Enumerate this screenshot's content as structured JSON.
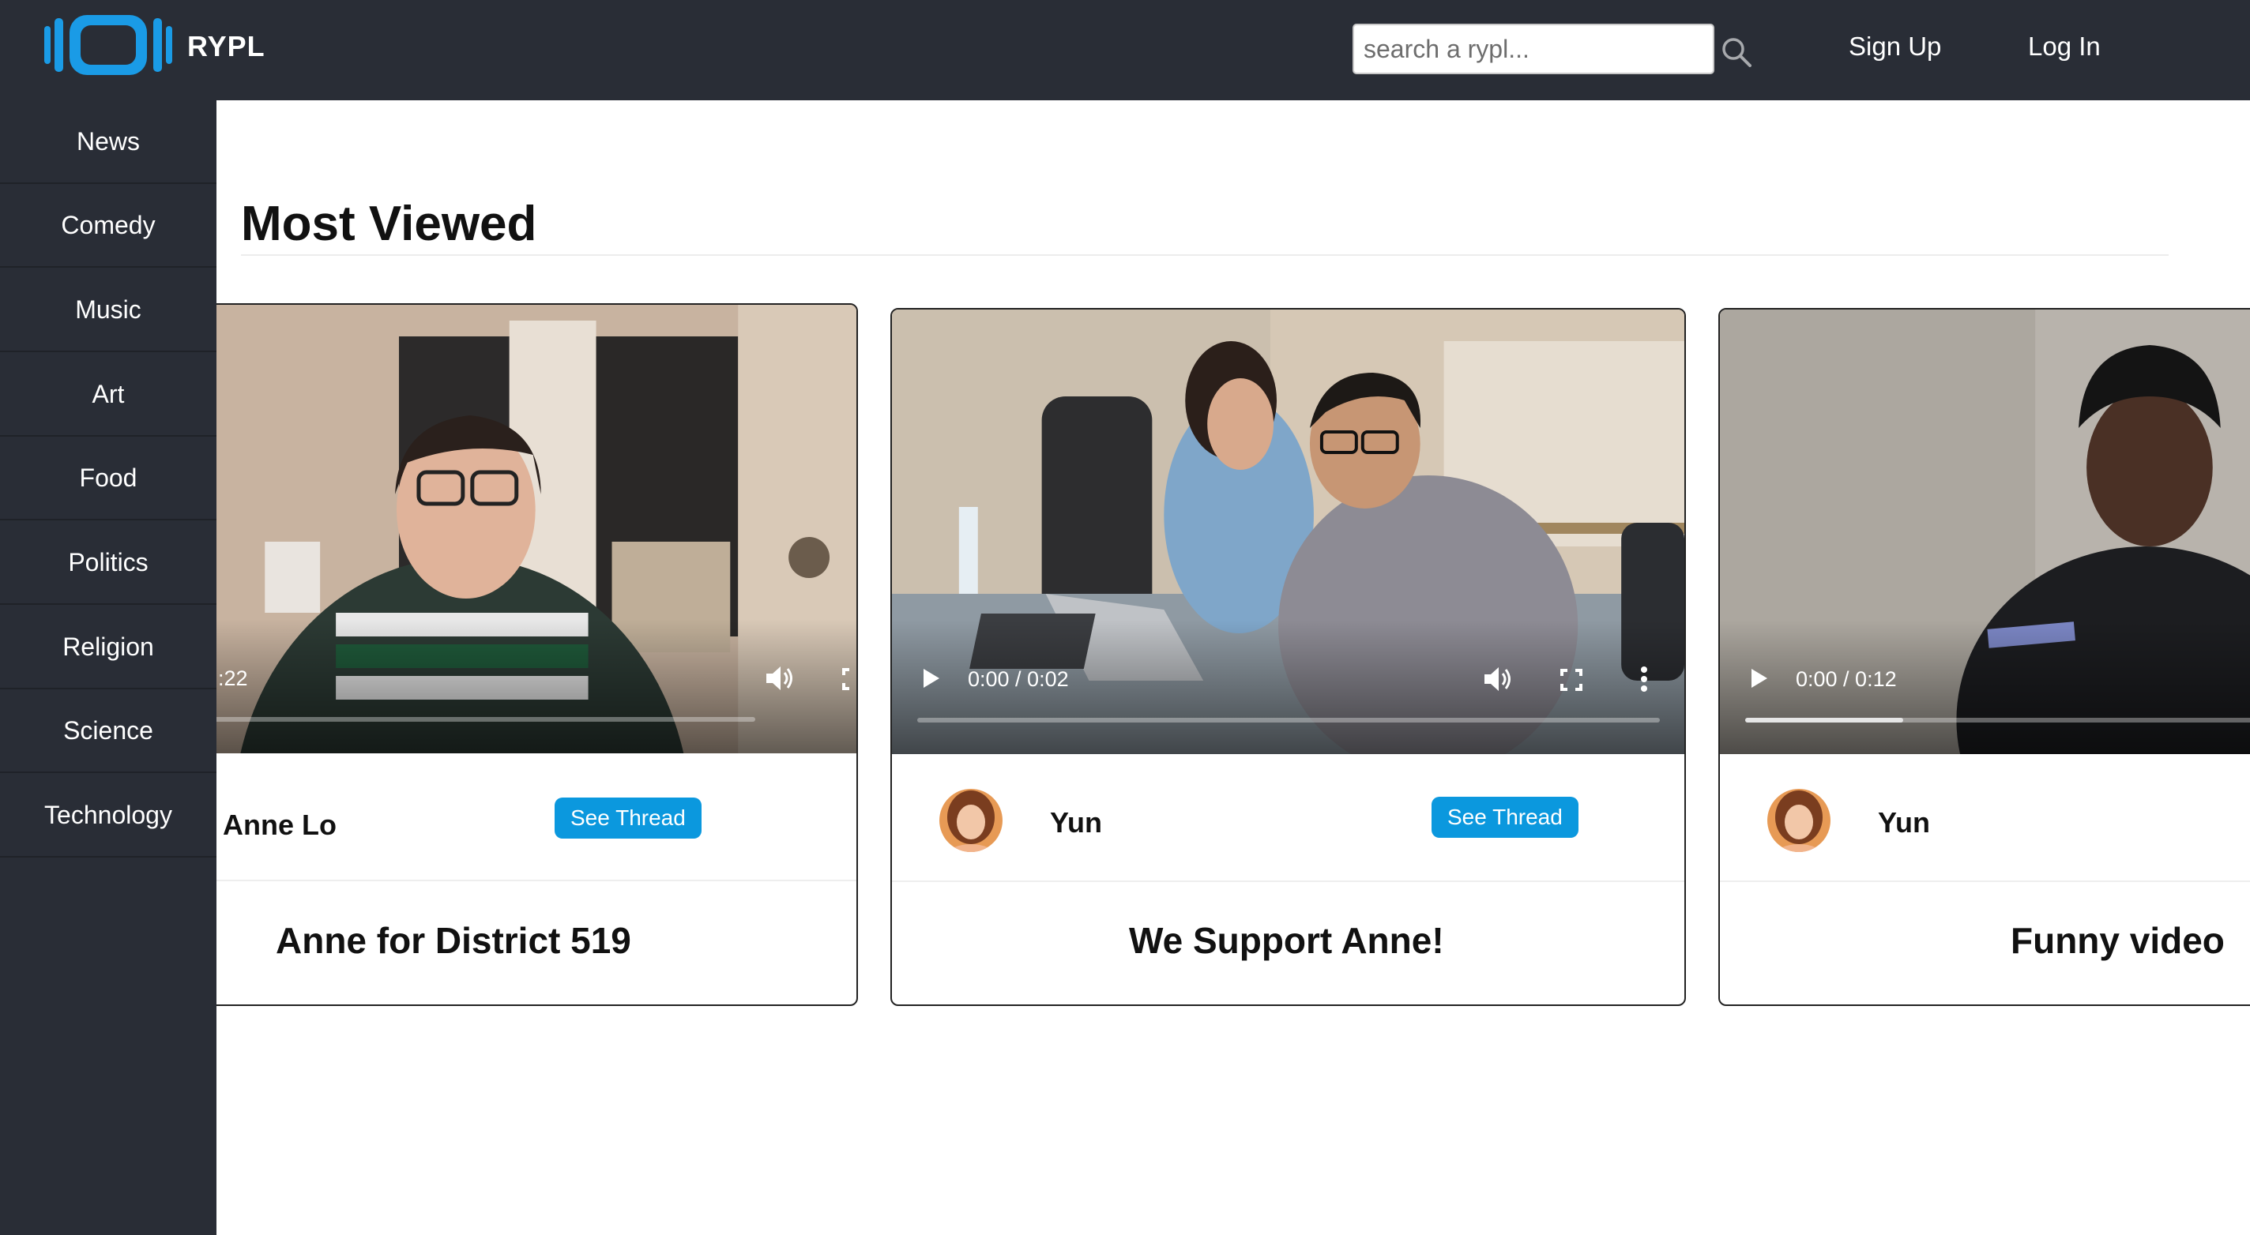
{
  "header": {
    "brand": "RYPL",
    "search_placeholder": "search a rypl...",
    "signup": "Sign Up",
    "login": "Log In"
  },
  "sidebar": {
    "items": [
      {
        "label": "News"
      },
      {
        "label": "Comedy"
      },
      {
        "label": "Music"
      },
      {
        "label": "Art"
      },
      {
        "label": "Food"
      },
      {
        "label": "Politics"
      },
      {
        "label": "Religion"
      },
      {
        "label": "Science"
      },
      {
        "label": "Technology"
      }
    ]
  },
  "main": {
    "section_title": "Most Viewed",
    "see_thread": "See Thread",
    "cards": [
      {
        "time": ":22",
        "author": "Anne Lo",
        "title": "Anne for District 519",
        "progress": 0.03
      },
      {
        "time": "0:00 / 0:02",
        "author": "Yun",
        "title": "We Support Anne!",
        "progress": 0.0
      },
      {
        "time": "0:00 / 0:12",
        "author": "Yun",
        "title": "Funny video",
        "progress": 0.25
      }
    ]
  },
  "colors": {
    "header_bg": "#292d36",
    "logo_blue": "#1a9be6",
    "button_blue": "#0b98de"
  }
}
